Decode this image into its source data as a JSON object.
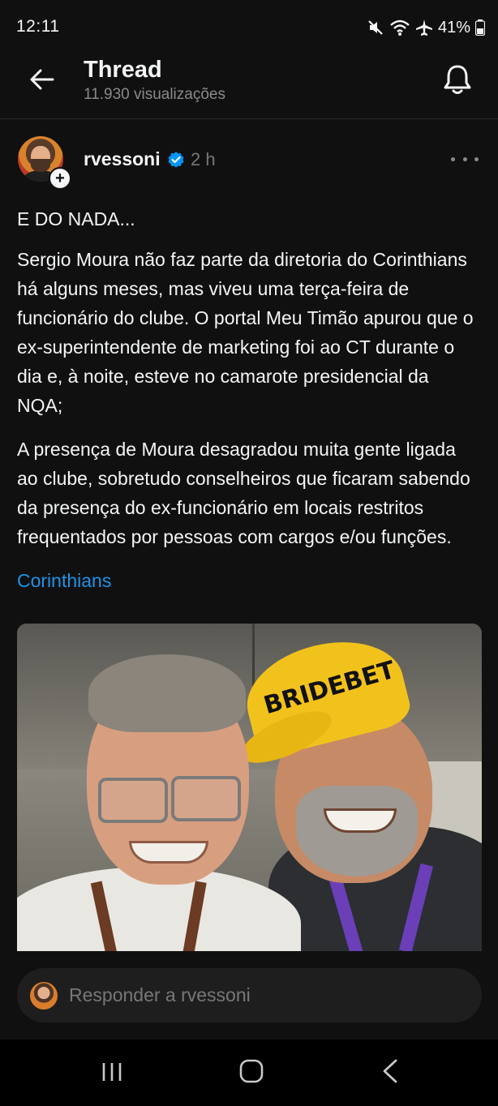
{
  "status_bar": {
    "time": "12:11",
    "battery": "41%",
    "icons": [
      "mute-icon",
      "wifi-icon",
      "airplane-icon",
      "battery-icon"
    ]
  },
  "header": {
    "title": "Thread",
    "subtitle": "11.930 visualizações",
    "back_icon": "arrow-left-icon",
    "bell_icon": "bell-icon"
  },
  "post": {
    "username": "rvessoni",
    "time": "2 h",
    "verified": true,
    "paragraphs": [
      "E DO NADA...",
      "Sergio Moura não faz parte da diretoria do Corinthians há alguns meses, mas viveu uma terça-feira de funcionário do clube. O portal Meu Timão apurou que o ex-superintendente de marketing foi ao CT durante o dia e, à noite, esteve no camarote presidencial da NQA;",
      "A presença de Moura desagradou muita gente ligada ao clube, sobretudo conselheiros que ficaram sabendo da presença do ex-funcionário em locais restritos frequentados por pessoas com cargos e/ou funções."
    ],
    "tag": "Corinthians",
    "image_text": "BRIDEBET"
  },
  "reply": {
    "placeholder": "Responder a rvessoni"
  },
  "colors": {
    "background": "#101010",
    "text": "#f3f5f7",
    "muted": "#777777",
    "link": "#1e93e8",
    "verified": "#0095f6"
  }
}
